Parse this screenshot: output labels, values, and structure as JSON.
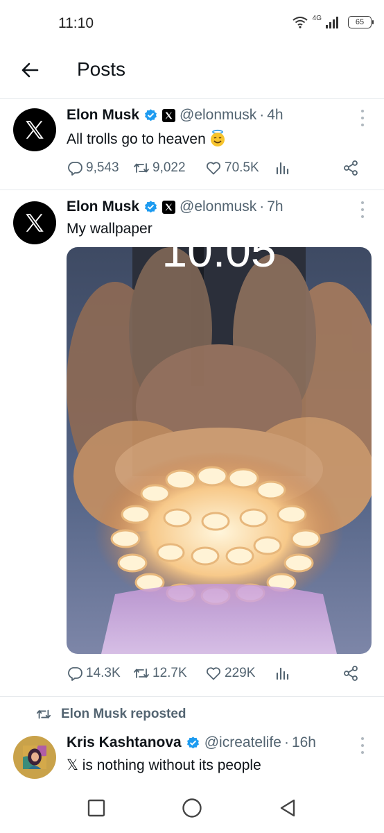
{
  "status_bar": {
    "time": "11:10",
    "network": "4G",
    "battery": "65"
  },
  "header": {
    "title": "Posts"
  },
  "posts": [
    {
      "author": "Elon Musk",
      "handle": "@elonmusk",
      "time": "4h",
      "text": "All trolls go to heaven",
      "emoji": "smiling-face-with-halo",
      "replies": "9,543",
      "reposts": "9,022",
      "likes": "70.5K"
    },
    {
      "author": "Elon Musk",
      "handle": "@elonmusk",
      "time": "7h",
      "text": "My wallpaper",
      "image_clock_text": "10:05",
      "replies": "14.3K",
      "reposts": "12.7K",
      "likes": "229K"
    },
    {
      "repost_label": "Elon Musk reposted",
      "author": "Kris Kashtanova",
      "handle": "@icreatelife",
      "time": "16h",
      "text": "𝕏 is nothing without its people"
    }
  ],
  "colors": {
    "verified": "#1d9bf0",
    "secondary_text": "#536471",
    "divider": "#e6e9ec"
  }
}
